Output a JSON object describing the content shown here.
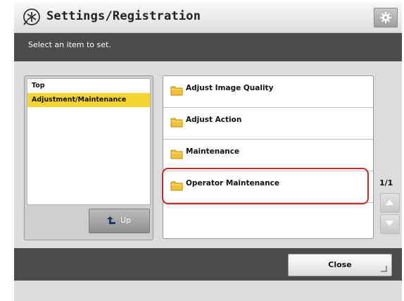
{
  "header": {
    "title": "Settings/Registration",
    "title_icon": "settings-registration-icon",
    "settings_button_icon": "gear-icon"
  },
  "instruction": "Select an item to set.",
  "tree": {
    "items": [
      {
        "label": "Top",
        "selected": false
      },
      {
        "label": "Adjustment/Maintenance",
        "selected": true
      }
    ],
    "up_label": "Up",
    "up_icon": "up-arrow-icon"
  },
  "list": {
    "items": [
      {
        "label": "Adjust Image Quality",
        "icon": "folder-icon"
      },
      {
        "label": "Adjust Action",
        "icon": "folder-icon"
      },
      {
        "label": "Maintenance",
        "icon": "folder-icon"
      },
      {
        "label": "Operator Maintenance",
        "icon": "folder-icon",
        "highlighted": true
      }
    ],
    "page_indicator": "1/1"
  },
  "footer": {
    "close_label": "Close"
  },
  "colors": {
    "selected": "#f5d530",
    "highlight": "#cf2a2a",
    "bar": "#4b4b4b"
  }
}
